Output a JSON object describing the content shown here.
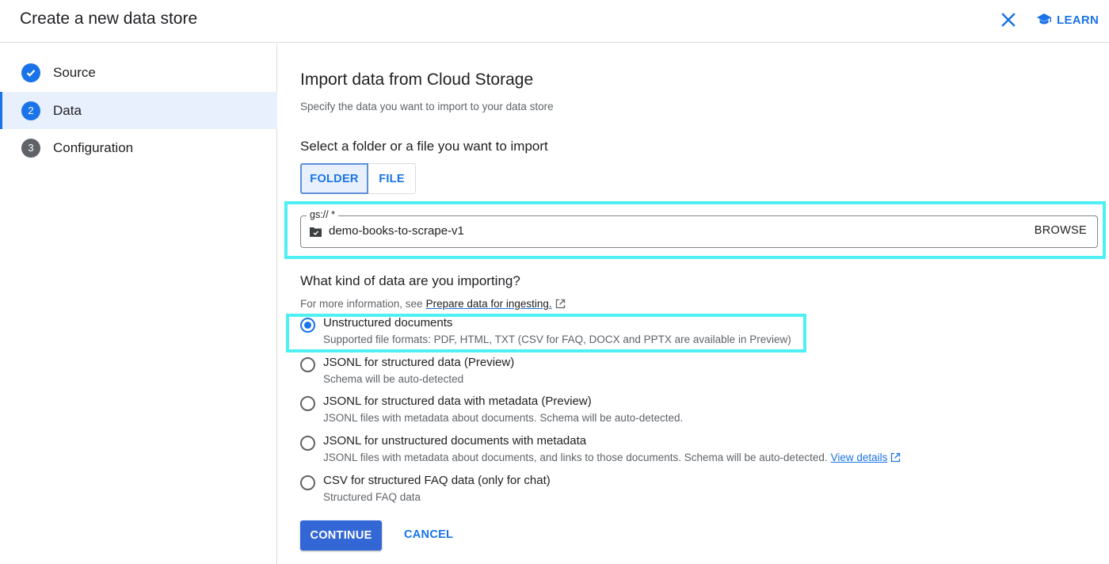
{
  "header": {
    "title": "Create a new data store",
    "close_icon": "close-icon",
    "learn_label": "LEARN",
    "learn_icon": "school-icon"
  },
  "sidebar": {
    "steps": [
      {
        "num": "✓",
        "label": "Source",
        "state": "done"
      },
      {
        "num": "2",
        "label": "Data",
        "state": "active"
      },
      {
        "num": "3",
        "label": "Configuration",
        "state": "pending"
      }
    ]
  },
  "main": {
    "title": "Import data from Cloud Storage",
    "subtitle": "Specify the data you want to import to your data store",
    "select_heading": "Select a folder or a file you want to import",
    "toggle": {
      "folder": "FOLDER",
      "file": "FILE",
      "selected": "FOLDER"
    },
    "gs_field": {
      "label": "gs:// *",
      "value": "demo-books-to-scrape-v1",
      "browse": "BROWSE"
    },
    "kind_heading": "What kind of data are you importing?",
    "info_prefix": "For more information, see",
    "info_link": "Prepare data for ingesting.",
    "options": [
      {
        "title": "Unstructured documents",
        "desc": "Supported file formats: PDF, HTML, TXT (CSV for FAQ, DOCX and PPTX are available in Preview)",
        "checked": true
      },
      {
        "title": "JSONL for structured data (Preview)",
        "desc": "Schema will be auto-detected",
        "checked": false
      },
      {
        "title": "JSONL for structured data with metadata (Preview)",
        "desc": "JSONL files with metadata about documents. Schema will be auto-detected.",
        "checked": false
      },
      {
        "title": "JSONL for unstructured documents with metadata",
        "desc": "JSONL files with metadata about documents, and links to those documents. Schema will be auto-detected.",
        "link": "View details",
        "checked": false
      },
      {
        "title": "CSV for structured FAQ data (only for chat)",
        "desc": "Structured FAQ data",
        "checked": false
      }
    ],
    "continue_label": "CONTINUE",
    "cancel_label": "CANCEL"
  },
  "colors": {
    "accent": "#1a73e8",
    "primary_button": "#3367d6",
    "highlight": "#4ef0f4",
    "step_done": "#1a73e8",
    "step_pending": "#5f6368"
  }
}
